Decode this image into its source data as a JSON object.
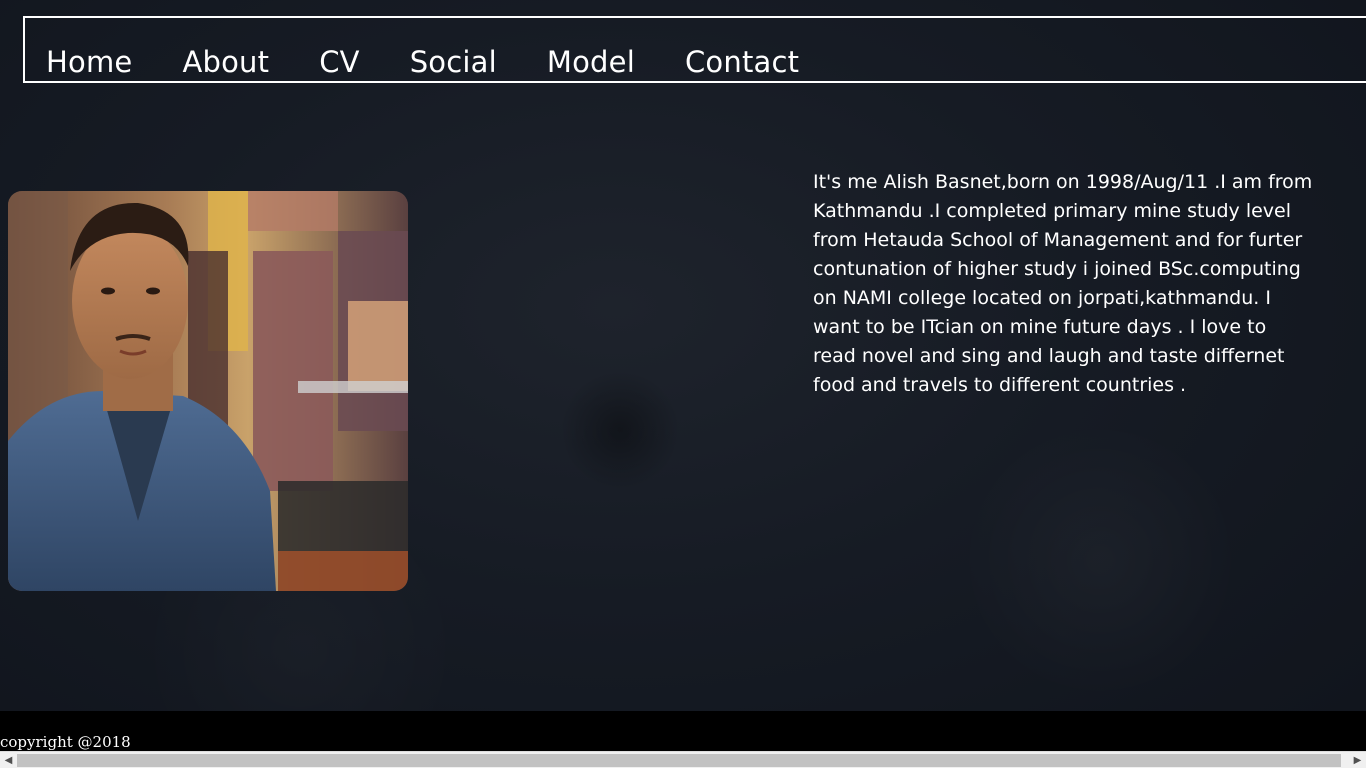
{
  "nav": {
    "items": [
      {
        "label": "Home"
      },
      {
        "label": "About"
      },
      {
        "label": "CV"
      },
      {
        "label": "Social"
      },
      {
        "label": "Model"
      },
      {
        "label": "Contact"
      }
    ]
  },
  "profile": {
    "bio": "It's me Alish Basnet,born on 1998/Aug/11 .I am from Kathmandu .I completed primary mine study level from Hetauda School of Management and for furter contunation of higher study i joined BSc.computing on NAMI college located on jorpati,kathmandu. I want to be ITcian on mine future days . I love to read novel and sing and laugh and taste differnet food and travels to different countries ."
  },
  "footer": {
    "copyright": "copyright @2018"
  },
  "scrollbar": {
    "left_icon": "arrow-left-icon",
    "right_icon": "arrow-right-icon"
  },
  "colors": {
    "background": "#161b24",
    "footer": "#000000",
    "text": "#ffffff"
  }
}
